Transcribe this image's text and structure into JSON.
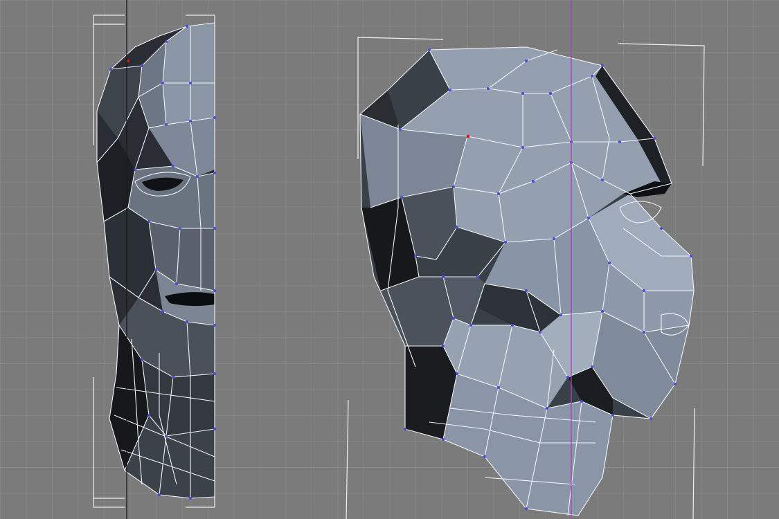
{
  "viewport": {
    "views": [
      "front",
      "side"
    ]
  },
  "colors": {
    "background": "#7b7b7b",
    "grid": "#919191",
    "wireframe": "#f2f4f8",
    "vertex": "#4a4ae0",
    "selected_vertex": "#d01818",
    "axis_line_front": "#1a1a1a",
    "axis_line_side": "#b030c8",
    "shade_light": "#8e9aaa",
    "shade_mid": "#5d6572",
    "shade_dark": "#2e3238",
    "shade_black": "#111316"
  }
}
